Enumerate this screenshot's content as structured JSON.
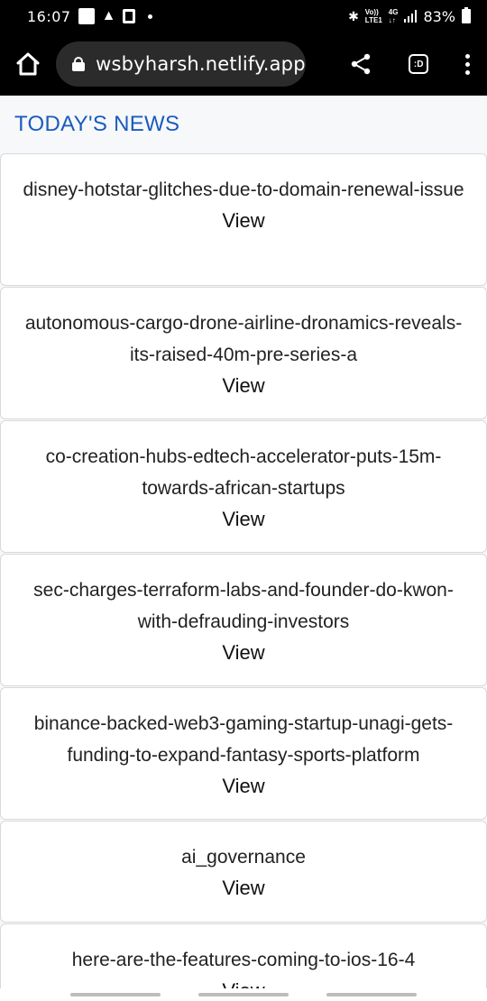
{
  "status_bar": {
    "time": "16:07",
    "battery": "83%",
    "volte_top": "Vo))",
    "volte_bottom": "LTE1",
    "net_top": "4G",
    "net_bottom": "↓↑"
  },
  "browser": {
    "url": "wsbyharsh.netlify.app",
    "extension_label": ":D"
  },
  "page": {
    "title": "TODAY'S NEWS",
    "news": [
      {
        "title": "disney-hotstar-glitches-due-to-domain-renewal-issue",
        "link": "View"
      },
      {
        "title": "autonomous-cargo-drone-airline-dronamics-reveals-its-raised-40m-pre-series-a",
        "link": "View"
      },
      {
        "title": "co-creation-hubs-edtech-accelerator-puts-15m-towards-african-startups",
        "link": "View"
      },
      {
        "title": "sec-charges-terraform-labs-and-founder-do-kwon-with-defrauding-investors",
        "link": "View"
      },
      {
        "title": "binance-backed-web3-gaming-startup-unagi-gets-funding-to-expand-fantasy-sports-platform",
        "link": "View"
      },
      {
        "title": "ai_governance",
        "link": "View"
      },
      {
        "title": "here-are-the-features-coming-to-ios-16-4",
        "link": "View"
      }
    ]
  },
  "colors": {
    "title_blue": "#1a5cbd",
    "toolbar_bg": "#000000",
    "url_box_bg": "#2b2b2b"
  }
}
